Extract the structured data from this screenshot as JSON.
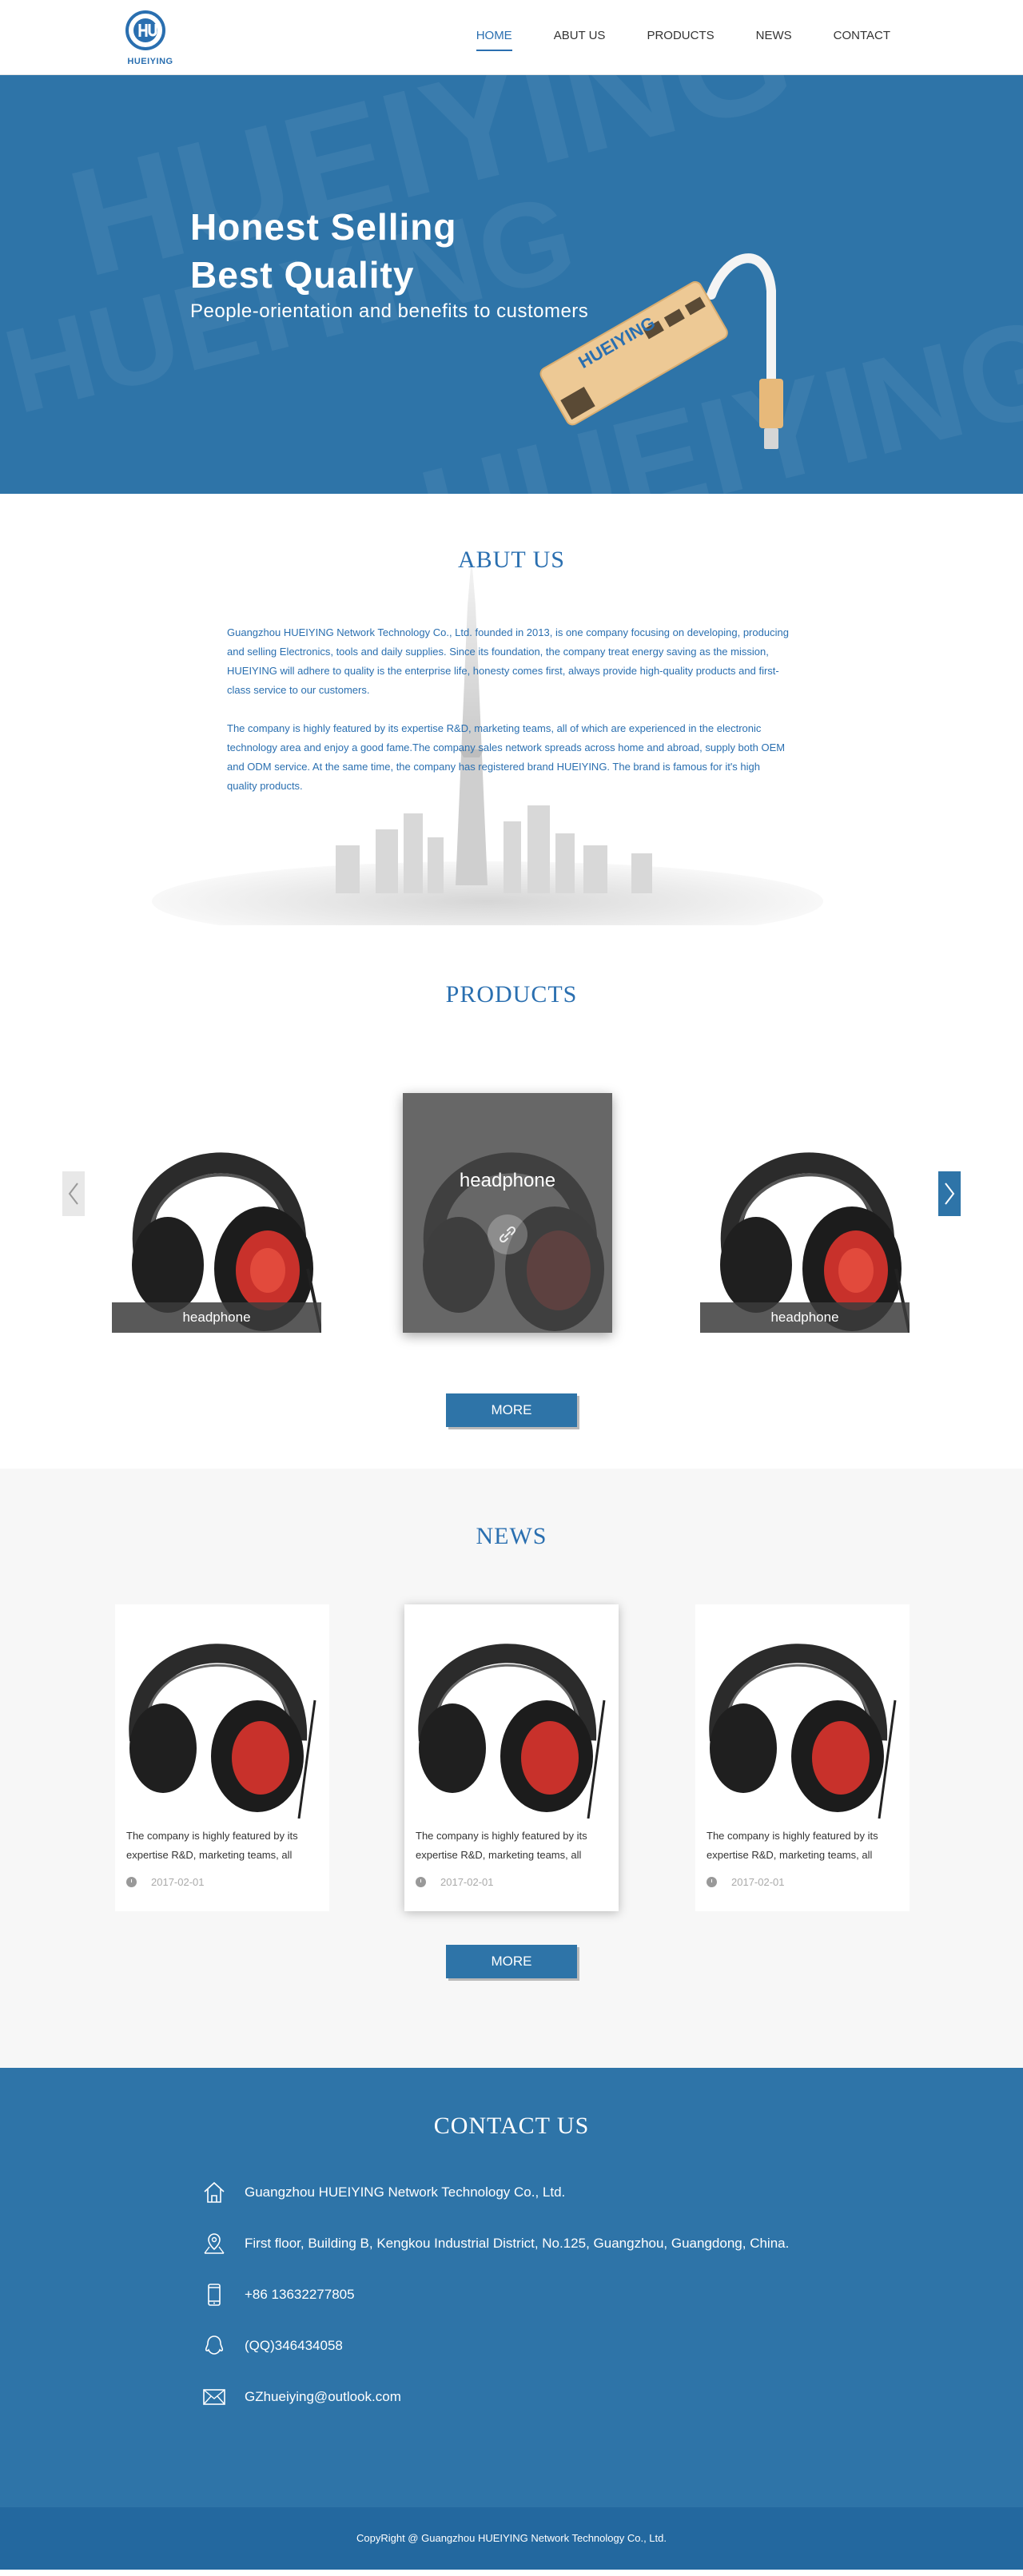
{
  "brand": {
    "logo_text": "HUEIYING"
  },
  "nav": {
    "items": [
      {
        "label": "HOME",
        "active": true
      },
      {
        "label": "ABUT US",
        "active": false
      },
      {
        "label": "PRODUCTS",
        "active": false
      },
      {
        "label": "NEWS",
        "active": false
      },
      {
        "label": "CONTACT",
        "active": false
      }
    ]
  },
  "banner": {
    "title_line1": "Honest Selling",
    "title_line2": "Best Quality",
    "subtitle": "People-orientation and benefits to customers",
    "product_label": "HUEIYING",
    "watermark": "HUEIYING",
    "slides": 3,
    "active_slide": 1
  },
  "about": {
    "title": "ABUT US",
    "paragraph1": "Guangzhou HUEIYING Network Technology  Co., Ltd. founded in 2013, is one company focusing on developing, producing and selling Electronics, tools and daily supplies. Since its foundation, the company treat energy saving as the mission, HUEIYING will adhere to quality is the enterprise life, honesty comes first, always provide high-quality products and first-class service to our customers.",
    "paragraph2": "The company is highly featured by its expertise R&D, marketing teams, all of which are experienced in the electronic technology area and enjoy a good fame.The company sales network spreads across home and abroad, supply both OEM and ODM service. At the same time, the company has registered brand HUEIYING. The brand is famous for it's high quality products."
  },
  "products": {
    "title": "PRODUCTS",
    "items": [
      {
        "label": "headphone"
      },
      {
        "label": "headphone"
      },
      {
        "label": "headphone"
      }
    ],
    "more_label": "MORE"
  },
  "news": {
    "title": "NEWS",
    "items": [
      {
        "text": "The company is highly featured by its expertise R&D, marketing teams, all",
        "date": "2017-02-01"
      },
      {
        "text": "The company is highly featured by its expertise R&D, marketing teams, all",
        "date": "2017-02-01"
      },
      {
        "text": "The company is highly featured by its expertise R&D, marketing teams, all",
        "date": "2017-02-01"
      }
    ],
    "more_label": "MORE"
  },
  "contact": {
    "title": "CONTACT US",
    "company": "Guangzhou HUEIYING Network Technology  Co., Ltd.",
    "address": "First floor, Building B, Kengkou Industrial District, No.125, Guangzhou, Guangdong, China.",
    "phone": "+86 13632277805",
    "qq": "(QQ)346434058",
    "email": "GZhueiying@outlook.com"
  },
  "footer": {
    "copyright": "CopyRight @ Guangzhou HUEIYING Network Technology  Co., Ltd."
  }
}
